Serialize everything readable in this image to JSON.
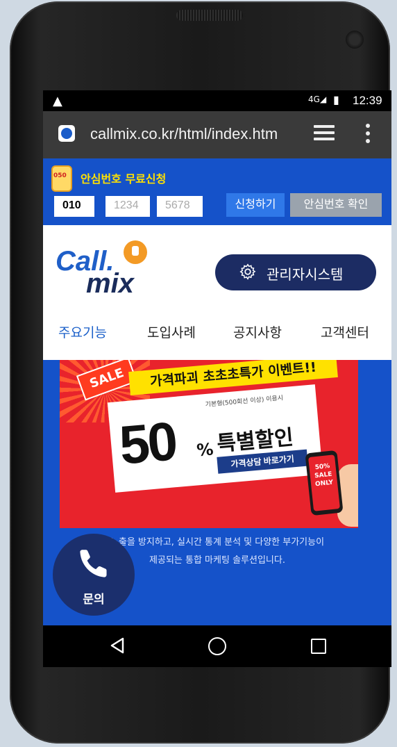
{
  "status_bar": {
    "time": "12:39",
    "network": "4G"
  },
  "browser": {
    "url": "callmix.co.kr/html/index.htm"
  },
  "top_banner": {
    "title": "안심번호 무료신청",
    "phone_prefix": "010",
    "phone_mid": "1234",
    "phone_last": "5678",
    "apply_label": "신청하기",
    "check_label": "안심번호 확인",
    "icon_badge": "050"
  },
  "header": {
    "logo_call": "Call.",
    "logo_mix": "mix",
    "admin_label": "관리자시스템"
  },
  "nav": {
    "items": [
      "주요기능",
      "도입사례",
      "공지사항",
      "고객센터"
    ]
  },
  "promo": {
    "sale_tag": "SALE",
    "headline": "가격파괴 초초초특가 이벤트!!",
    "note": "기본형(500회선 이상) 이용시",
    "big_number": "50",
    "percent": "%",
    "special": "특별할인",
    "link_label": "가격상담 바로가기",
    "phone_text": "50% SALE ONLY"
  },
  "description": {
    "line1": "노출을 방지하고, 실시간 통계 분석 및 다양한 부가기능이",
    "line2": "제공되는 통합 마케팅 솔루션입니다."
  },
  "call_fab": {
    "label": "문의"
  },
  "colors": {
    "brand_blue": "#1552c9",
    "navy": "#1c2c63",
    "accent_yellow": "#ffe100",
    "promo_red": "#e8232c"
  }
}
